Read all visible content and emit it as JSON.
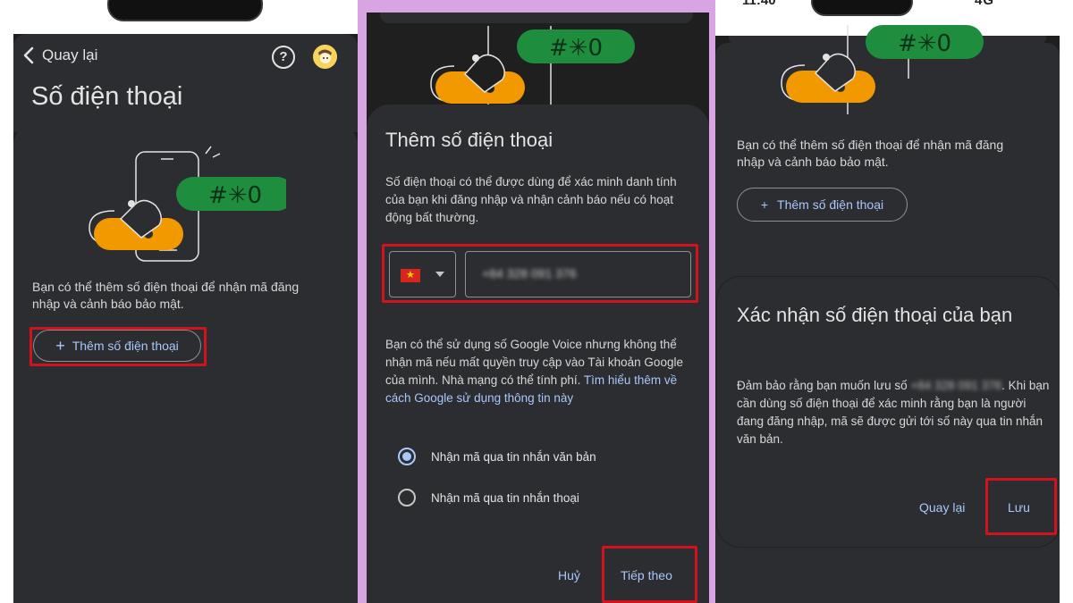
{
  "panel1": {
    "back_label": "Quay lại",
    "help_icon": "?",
    "title": "Số điện thoại",
    "illustration_code": "#✳0",
    "description": "Bạn có thể thêm số điện thoại để nhận mã đăng nhập và cảnh báo bảo mật.",
    "add_button": "Thêm số điện thoại",
    "add_icon": "+"
  },
  "panel2": {
    "illustration_code": "#✳0",
    "title": "Thêm số điện thoại",
    "description": "Số điện thoại có thể được dùng để xác minh danh tính của bạn khi đăng nhập và nhận cảnh báo nếu có hoạt động bất thường.",
    "phone_value": "+84 328 091 376",
    "voice_text": "Bạn có thể sử dụng số Google Voice nhưng không thể nhận mã nếu mất quyền truy cập vào Tài khoản Google của mình. Nhà mạng có thể tính phí. ",
    "voice_link": "Tìm hiểu thêm về cách Google sử dụng thông tin này",
    "radio_sms": "Nhận mã qua tin nhắn văn bản",
    "radio_voice": "Nhận mã qua tin nhắn thoại",
    "cancel_label": "Huỷ",
    "next_label": "Tiếp theo"
  },
  "panel3": {
    "status_time": "11:40",
    "status_signal": "4G",
    "illustration_code": "#✳0",
    "description": "Bạn có thể thêm số điện thoại để nhận mã đăng nhập và cảnh báo bảo mật.",
    "add_button": "Thêm số điện thoại",
    "add_icon": "+",
    "dialog_title": "Xác nhận số điện thoại của bạn",
    "dialog_body_prefix": "Đảm bảo rằng bạn muốn lưu số ",
    "dialog_phone": "+84 328 091 376",
    "dialog_body_suffix": ". Khi bạn cần dùng số điện thoại để xác minh rằng bạn là người đang đăng nhập, mã sẽ được gửi tới số này qua tin nhắn văn bản.",
    "back_label": "Quay lại",
    "save_label": "Lưu"
  },
  "colors": {
    "background": "#1f1f1f",
    "surface": "#2b2d30",
    "accent": "#a8c7fa",
    "highlight": "#d0131d",
    "green": "#1e8e3e",
    "yellow": "#f29900",
    "divider": "#d9a4e3"
  }
}
